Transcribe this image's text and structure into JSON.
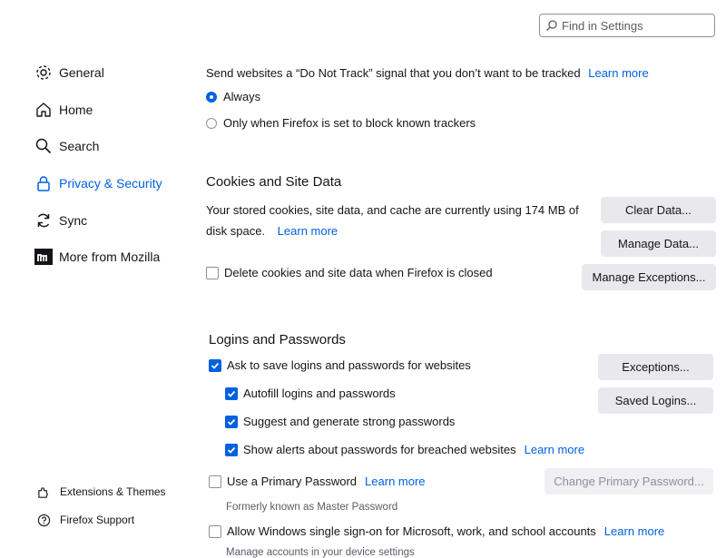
{
  "search": {
    "placeholder": "Find in Settings"
  },
  "nav": {
    "items": [
      {
        "label": "General"
      },
      {
        "label": "Home"
      },
      {
        "label": "Search"
      },
      {
        "label": "Privacy & Security"
      },
      {
        "label": "Sync"
      },
      {
        "label": "More from Mozilla"
      }
    ],
    "footer": [
      {
        "label": "Extensions & Themes"
      },
      {
        "label": "Firefox Support"
      }
    ]
  },
  "dnt": {
    "text": "Send websites a “Do Not Track” signal that you don’t want to be tracked",
    "learn_more": "Learn more",
    "options": [
      "Always",
      "Only when Firefox is set to block known trackers"
    ]
  },
  "cookies": {
    "title": "Cookies and Site Data",
    "desc_line1": "Your stored cookies, site data, and cache are currently using 174 MB of",
    "desc_line2": "disk space.",
    "learn_more": "Learn more",
    "delete_label": "Delete cookies and site data when Firefox is closed",
    "buttons": {
      "clear": "Clear Data...",
      "manage": "Manage Data...",
      "exceptions": "Manage Exceptions..."
    }
  },
  "logins": {
    "title": "Logins and Passwords",
    "ask_save": "Ask to save logins and passwords for websites",
    "autofill": "Autofill logins and passwords",
    "suggest": "Suggest and generate strong passwords",
    "alerts": "Show alerts about passwords for breached websites",
    "learn_more": "Learn more",
    "primary": "Use a Primary Password",
    "primary_sub": "Formerly known as Master Password",
    "sso": "Allow Windows single sign-on for Microsoft, work, and school accounts",
    "sso_sub": "Manage accounts in your device settings",
    "buttons": {
      "exceptions": "Exceptions...",
      "saved": "Saved Logins...",
      "change_primary": "Change Primary Password..."
    }
  },
  "colors": {
    "accent": "#0061e0",
    "button_bg": "#e9e9ed"
  }
}
